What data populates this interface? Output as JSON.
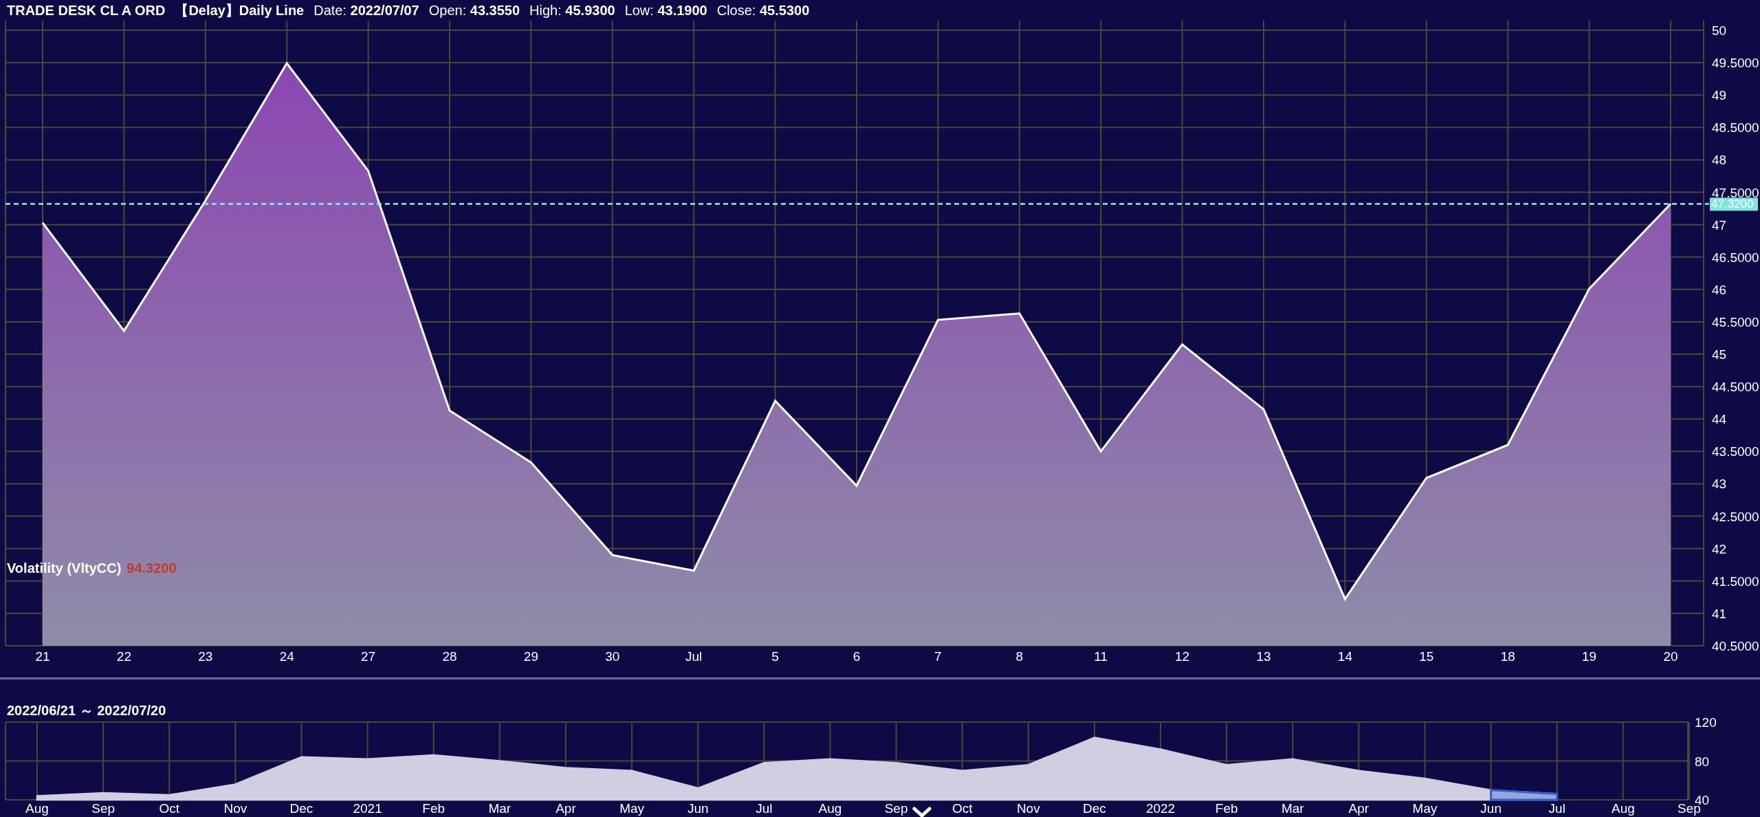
{
  "header": {
    "title": "TRADE DESK CL A ORD",
    "mode": "【Delay】Daily Line",
    "fields": [
      {
        "label": "Date:",
        "value": "2022/07/07"
      },
      {
        "label": "Open:",
        "value": "43.3550"
      },
      {
        "label": "High:",
        "value": "45.9300"
      },
      {
        "label": "Low:",
        "value": "43.1900"
      },
      {
        "label": "Close:",
        "value": "45.5300"
      }
    ]
  },
  "main_chart": {
    "indicator": {
      "label": "Volatility (VltyCC)",
      "value": "94.3200"
    },
    "chart_data": {
      "type": "area",
      "categories": [
        "21",
        "22",
        "23",
        "24",
        "27",
        "28",
        "29",
        "30",
        "Jul",
        "5",
        "6",
        "7",
        "8",
        "11",
        "12",
        "13",
        "14",
        "15",
        "18",
        "19",
        "20"
      ],
      "grid": true,
      "series": [
        {
          "color": "#ffffff",
          "values": [
            47.03,
            45.36,
            47.37,
            49.49,
            47.83,
            44.13,
            43.33,
            41.9,
            41.66,
            44.28,
            42.97,
            45.53,
            45.63,
            43.5,
            45.15,
            44.15,
            41.22,
            43.09,
            43.6,
            46.01,
            47.32
          ]
        }
      ],
      "ylim": [
        40.5,
        50
      ],
      "yticks": [
        {
          "value": 40.5,
          "label": "40.5000"
        },
        41,
        {
          "value": 41.5,
          "label": "41.5000"
        },
        42,
        {
          "value": 42.5,
          "label": "42.5000"
        },
        43,
        {
          "value": 43.5,
          "label": "43.5000"
        },
        44,
        {
          "value": 44.5,
          "label": "44.5000"
        },
        45,
        {
          "value": 45.5,
          "label": "45.5000"
        },
        46,
        {
          "value": 46.5,
          "label": "46.5000"
        },
        47,
        {
          "value": 47.5,
          "label": "47.5000"
        },
        48,
        {
          "value": 48.5,
          "label": "48.5000"
        },
        49,
        {
          "value": 49.5,
          "label": "49.5000"
        },
        50
      ],
      "ref_lines": [
        {
          "axis": "y",
          "value": 47.32,
          "label": "47.3200",
          "color": "#8ff0ea"
        }
      ]
    }
  },
  "navigator": {
    "range": "2022/06/21 ～ 2022/07/20",
    "chart_data": {
      "type": "area",
      "categories": [
        "Aug",
        "Sep",
        "Oct",
        "Nov",
        "Dec",
        "2021",
        "Feb",
        "Mar",
        "Apr",
        "May",
        "Jun",
        "Jul",
        "Aug",
        "Sep",
        "Oct",
        "Nov",
        "Dec",
        "2022",
        "Feb",
        "Mar",
        "Apr",
        "May",
        "Jun",
        "Jul",
        "Aug",
        "Sep"
      ],
      "grid": true,
      "series": [
        {
          "color": "#d0cee0",
          "values": [
            44,
            47,
            45,
            56,
            84,
            82,
            86,
            80,
            73,
            70,
            52,
            78,
            82,
            78,
            70,
            76,
            104,
            92,
            76,
            82,
            70,
            62,
            50,
            46,
            null,
            null
          ]
        },
        {
          "color": "#2f5fd0",
          "values": [
            null,
            null,
            null,
            null,
            null,
            null,
            null,
            null,
            null,
            null,
            null,
            null,
            null,
            null,
            null,
            null,
            null,
            null,
            null,
            null,
            null,
            null,
            50,
            46,
            null,
            null
          ]
        }
      ],
      "ylim": [
        40,
        120
      ],
      "yticks": [
        40,
        80,
        120
      ]
    }
  }
}
